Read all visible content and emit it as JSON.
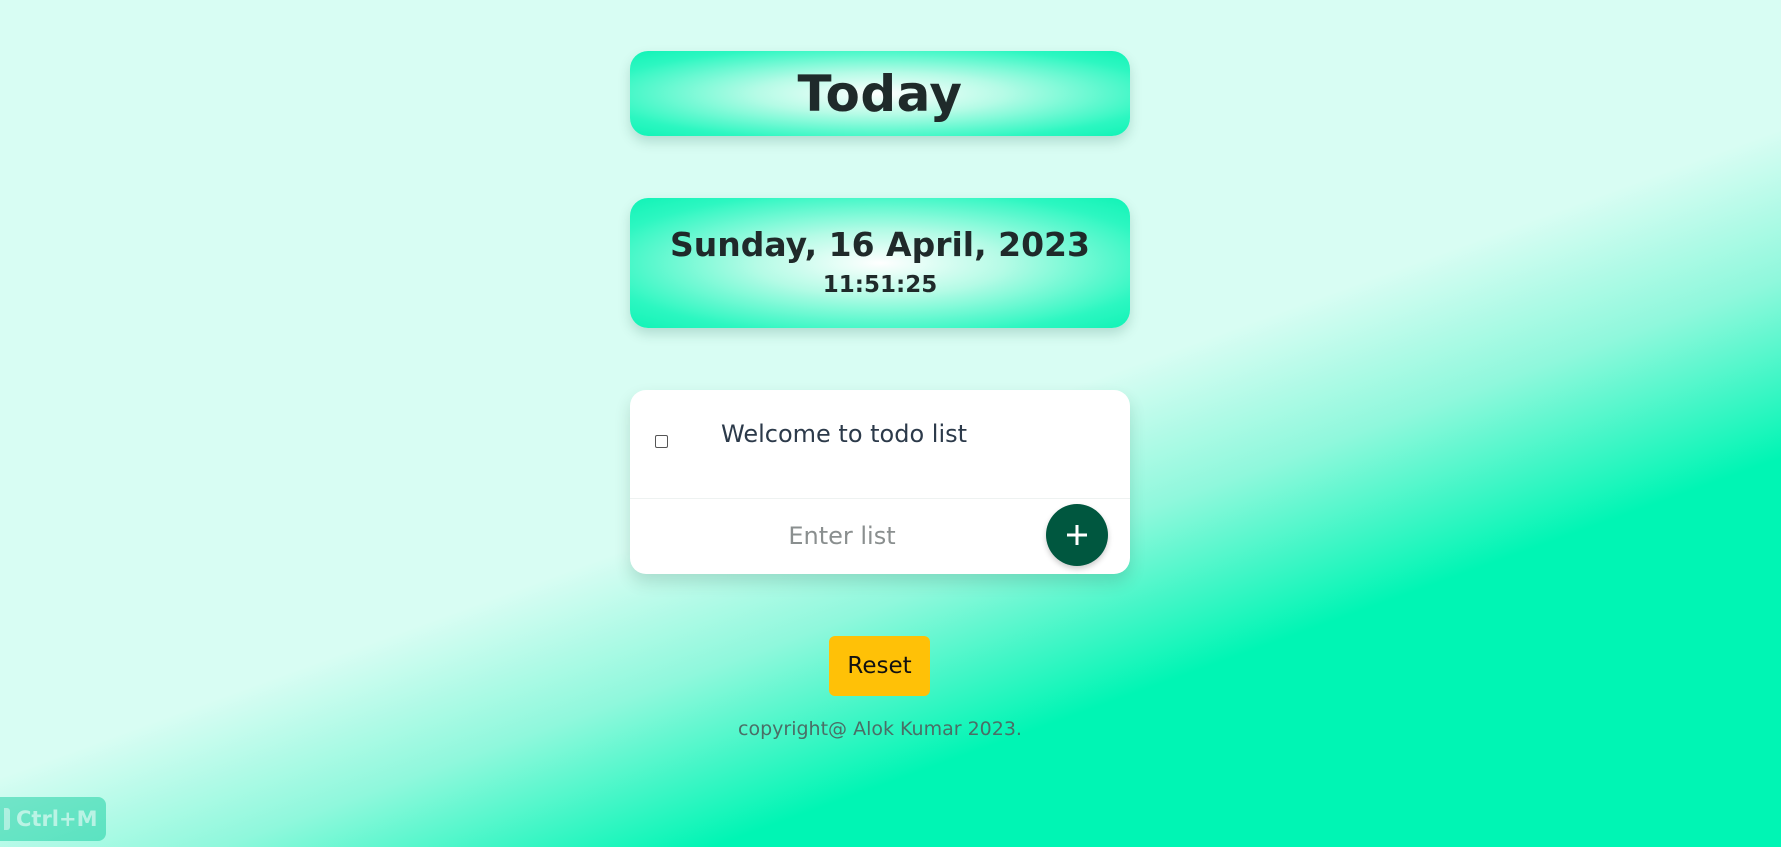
{
  "header": {
    "title": "Today"
  },
  "datetime": {
    "date": "Sunday, 16 April, 2023",
    "time": "11:51:25"
  },
  "todo": {
    "items": [
      {
        "text": "Welcome to todo list",
        "checked": false
      }
    ],
    "input": {
      "placeholder": "Enter list",
      "value": ""
    },
    "add_button_icon": "plus-icon"
  },
  "reset_label": "Reset",
  "footer": {
    "copyright": "copyright@ Alok Kumar 2023."
  },
  "shortcut_badge": {
    "label": "Ctrl+M",
    "icon": "keyboard-icon"
  },
  "colors": {
    "accent": "#00f5b4",
    "add_button": "#00573f",
    "reset_button": "#ffc107",
    "background": "#d8fdf3"
  }
}
